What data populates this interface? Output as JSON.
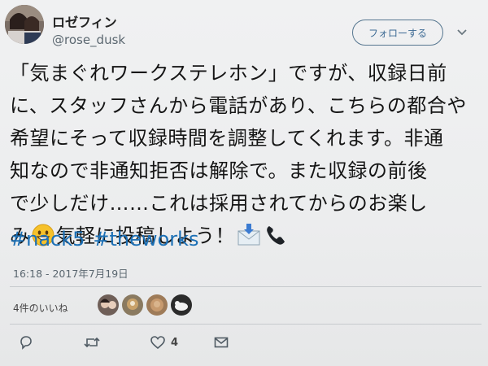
{
  "user": {
    "display_name": "ロゼフィン",
    "handle": "@rose_dusk",
    "avatar_icon": "user-avatar-icon"
  },
  "follow_label": "フォローする",
  "tweet_lines": [
    "「気まぐれワークステレホン」ですが、収録日前",
    "に、スタッフさんから電話があり、こちらの都合や",
    "希望にそって収録時間を調整してくれます。非通",
    "知なので非通知拒否は解除で。また収録の前後",
    "で少しだけ……これは採用されてからのお楽し"
  ],
  "last_line": {
    "before_emoji": "み",
    "after_emoji": "気軽に投稿しよう！"
  },
  "emojis": [
    "grinning-face-icon",
    "incoming-envelope-icon",
    "telephone-receiver-icon"
  ],
  "hashtags": [
    "#nack5",
    "#theworks"
  ],
  "timestamp": "16:18 - 2017年7月19日",
  "likes": {
    "label": "4件のいいね",
    "avatars": [
      "liker-avatar-1",
      "liker-avatar-2",
      "liker-avatar-3",
      "liker-avatar-4"
    ]
  },
  "actions": {
    "reply_icon": "reply-icon",
    "retweet_icon": "retweet-icon",
    "like_icon": "heart-icon",
    "like_count": "4",
    "dm_icon": "envelope-icon"
  },
  "colors": {
    "link": "#1b6fb5",
    "follow_border": "#55758f",
    "muted_text": "#5b6770"
  }
}
